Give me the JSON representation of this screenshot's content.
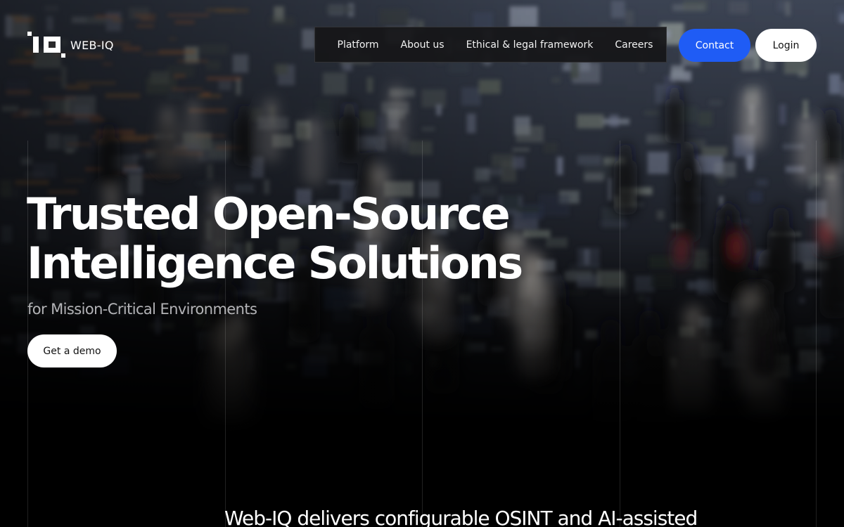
{
  "brand": {
    "logo_alt": "IQ",
    "name": "WEB-IQ"
  },
  "nav": {
    "items": [
      {
        "label": "Platform"
      },
      {
        "label": "About us"
      },
      {
        "label": "Ethical & legal framework"
      },
      {
        "label": "Careers"
      }
    ]
  },
  "actions": {
    "contact_label": "Contact",
    "login_label": "Login"
  },
  "hero": {
    "title_line1": "Trusted Open-Source",
    "title_line2": "Intelligence Solutions",
    "subtitle": "for Mission-Critical Environments",
    "cta_label": "Get a demo",
    "background_icon": "circuit-board-crowd-photo"
  },
  "intro": {
    "text": "Web-IQ delivers configurable OSINT and AI-assisted"
  },
  "colors": {
    "accent": "#1f5cf5",
    "background": "#000000",
    "nav_bg": "#161618",
    "button_light": "#ffffff"
  }
}
